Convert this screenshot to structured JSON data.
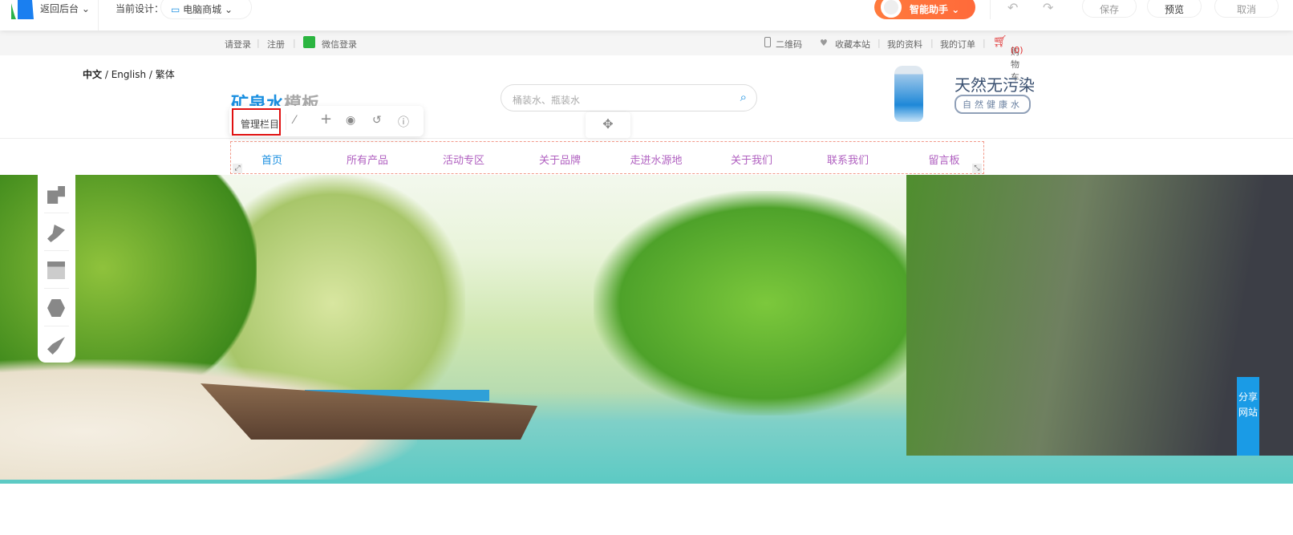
{
  "topbar": {
    "back_label": "返回后台",
    "current_design_label": "当前设计：",
    "design_value": "电脑商城",
    "assistant_label": "智能助手",
    "save": "保存",
    "preview": "预览",
    "cancel": "取消"
  },
  "subbar": {
    "login": "请登录",
    "register": "注册",
    "wechat_login": "微信登录",
    "qrcode": "二维码",
    "favorite": "收藏本站",
    "my_profile": "我的资料",
    "my_orders": "我的订单",
    "cart": "购物车",
    "cart_count": "(0)"
  },
  "header": {
    "lang_cn": "中文",
    "lang_en": "English",
    "lang_tw": "繁体",
    "lang_sep": "/",
    "brand_a": "矿泉水",
    "brand_b": "模板",
    "search_placeholder": "桶装水、瓶装水",
    "promo_title": "天然无污染",
    "promo_sub": "自然健康水"
  },
  "toolbar": {
    "manage_label": "管理栏目"
  },
  "nav": {
    "items": [
      "首页",
      "所有产品",
      "活动专区",
      "关于品牌",
      "走进水源地",
      "关于我们",
      "联系我们",
      "留言板"
    ]
  },
  "share": {
    "label": "分享网站"
  },
  "colors": {
    "accent": "#1a8fe0",
    "nav_text": "#b060c0",
    "assistant": "#ff7a3d",
    "share": "#1a9be6",
    "highlight": "#e01010"
  }
}
